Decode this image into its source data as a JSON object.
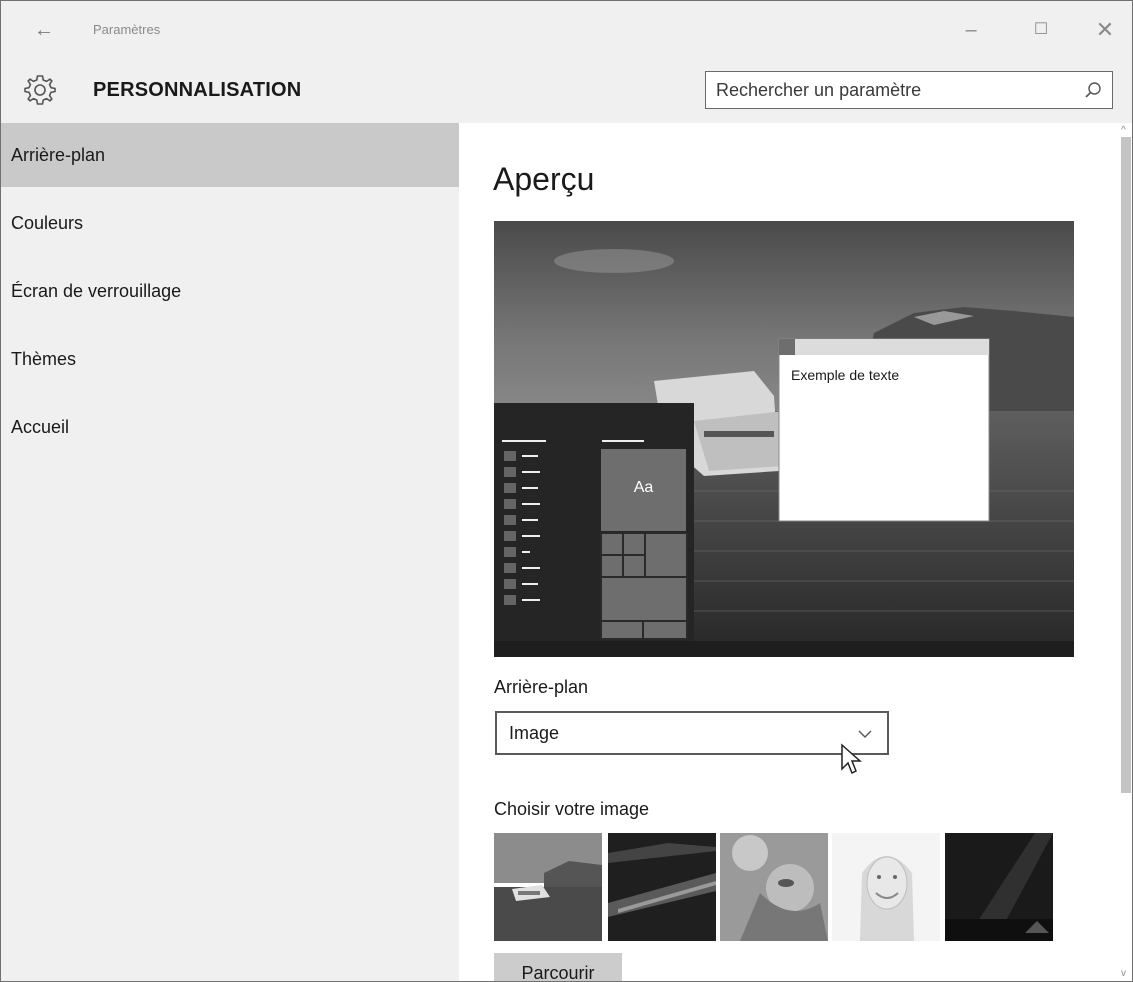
{
  "window": {
    "app_title": "Paramètres",
    "back_icon": "arrow-left-icon",
    "controls": {
      "minimize": "–",
      "maximize": "☐",
      "close": "✕"
    }
  },
  "header": {
    "section_title": "PERSONNALISATION",
    "search": {
      "placeholder": "Rechercher un paramètre"
    }
  },
  "sidebar": {
    "items": [
      {
        "label": "Arrière-plan",
        "selected": true
      },
      {
        "label": "Couleurs",
        "selected": false
      },
      {
        "label": "Écran de verrouillage",
        "selected": false
      },
      {
        "label": "Thèmes",
        "selected": false
      },
      {
        "label": "Accueil",
        "selected": false
      }
    ]
  },
  "main": {
    "title": "Aperçu",
    "preview": {
      "sample_text": "Exemple de texte",
      "tile_text": "Aa"
    },
    "background_label": "Arrière-plan",
    "background_value": "Image",
    "choose_label": "Choisir votre image",
    "browse_label": "Parcourir"
  },
  "colors": {
    "chrome": "#f0f0f0",
    "selected": "#c9c9c9",
    "tile": "#6e6e6e"
  }
}
